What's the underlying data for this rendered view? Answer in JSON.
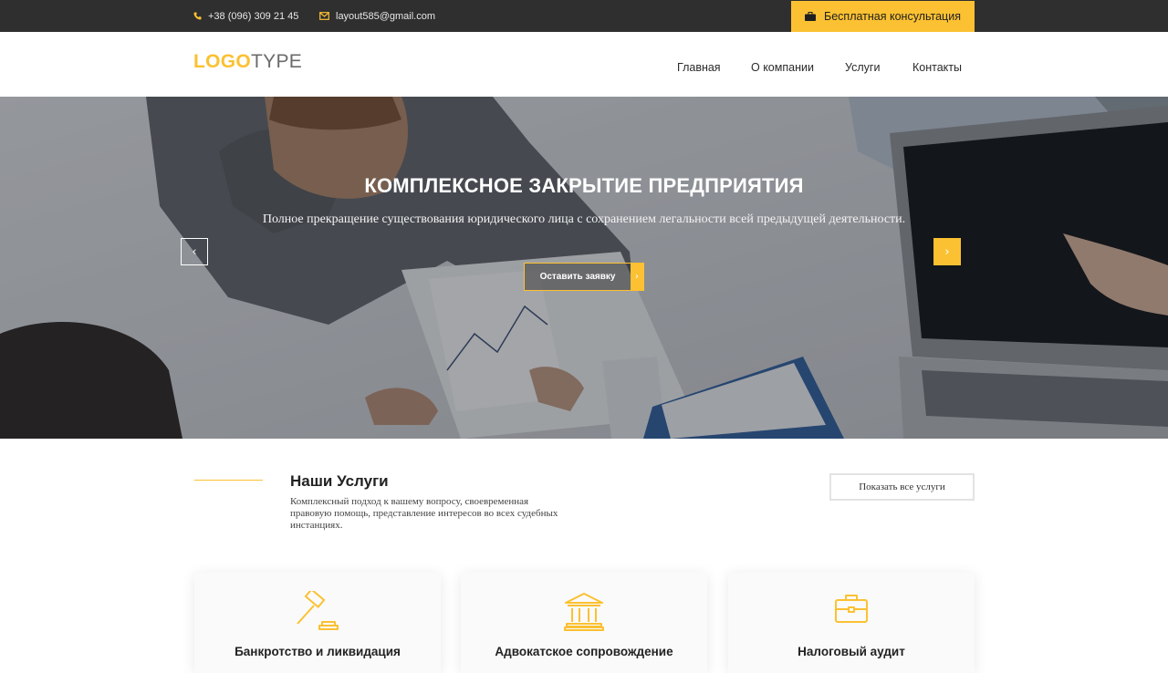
{
  "colors": {
    "accent": "#fbc132",
    "topbar_bg": "#2f2f2f"
  },
  "topbar": {
    "phone": "+38 (096) 309 21 45",
    "phone_icon": "phone-icon",
    "email": "layout585@gmail.com",
    "email_icon": "envelope-icon",
    "consult_label": "Бесплатная консультация",
    "consult_icon": "briefcase-icon"
  },
  "header": {
    "logo_part1": "LOGO",
    "logo_part2": "TYPE",
    "nav": [
      "Главная",
      "О компании",
      "Услуги",
      "Контакты"
    ]
  },
  "hero": {
    "title": "КОМПЛЕКСНОЕ ЗАКРЫТИЕ ПРЕДПРИЯТИЯ",
    "subtitle": "Полное прекращение существования юридического лица с сохранением легальности всей предыдущей деятельности.",
    "cta_label": "Оставить заявку",
    "prev_glyph": "‹",
    "next_glyph": "›",
    "cta_glyph": "›"
  },
  "services": {
    "title": "Наши Услуги",
    "description": "Комплексный подход к вашему вопросу, своевременная правовую помощь, представление интересов во всех судебных инстанциях.",
    "show_all_label": "Показать все услуги",
    "cards": [
      {
        "title": "Банкротство и ликвидация",
        "icon": "gavel-icon"
      },
      {
        "title": "Адвокатское сопровождение",
        "icon": "courthouse-icon"
      },
      {
        "title": "Налоговый аудит",
        "icon": "briefcase-icon"
      }
    ]
  }
}
